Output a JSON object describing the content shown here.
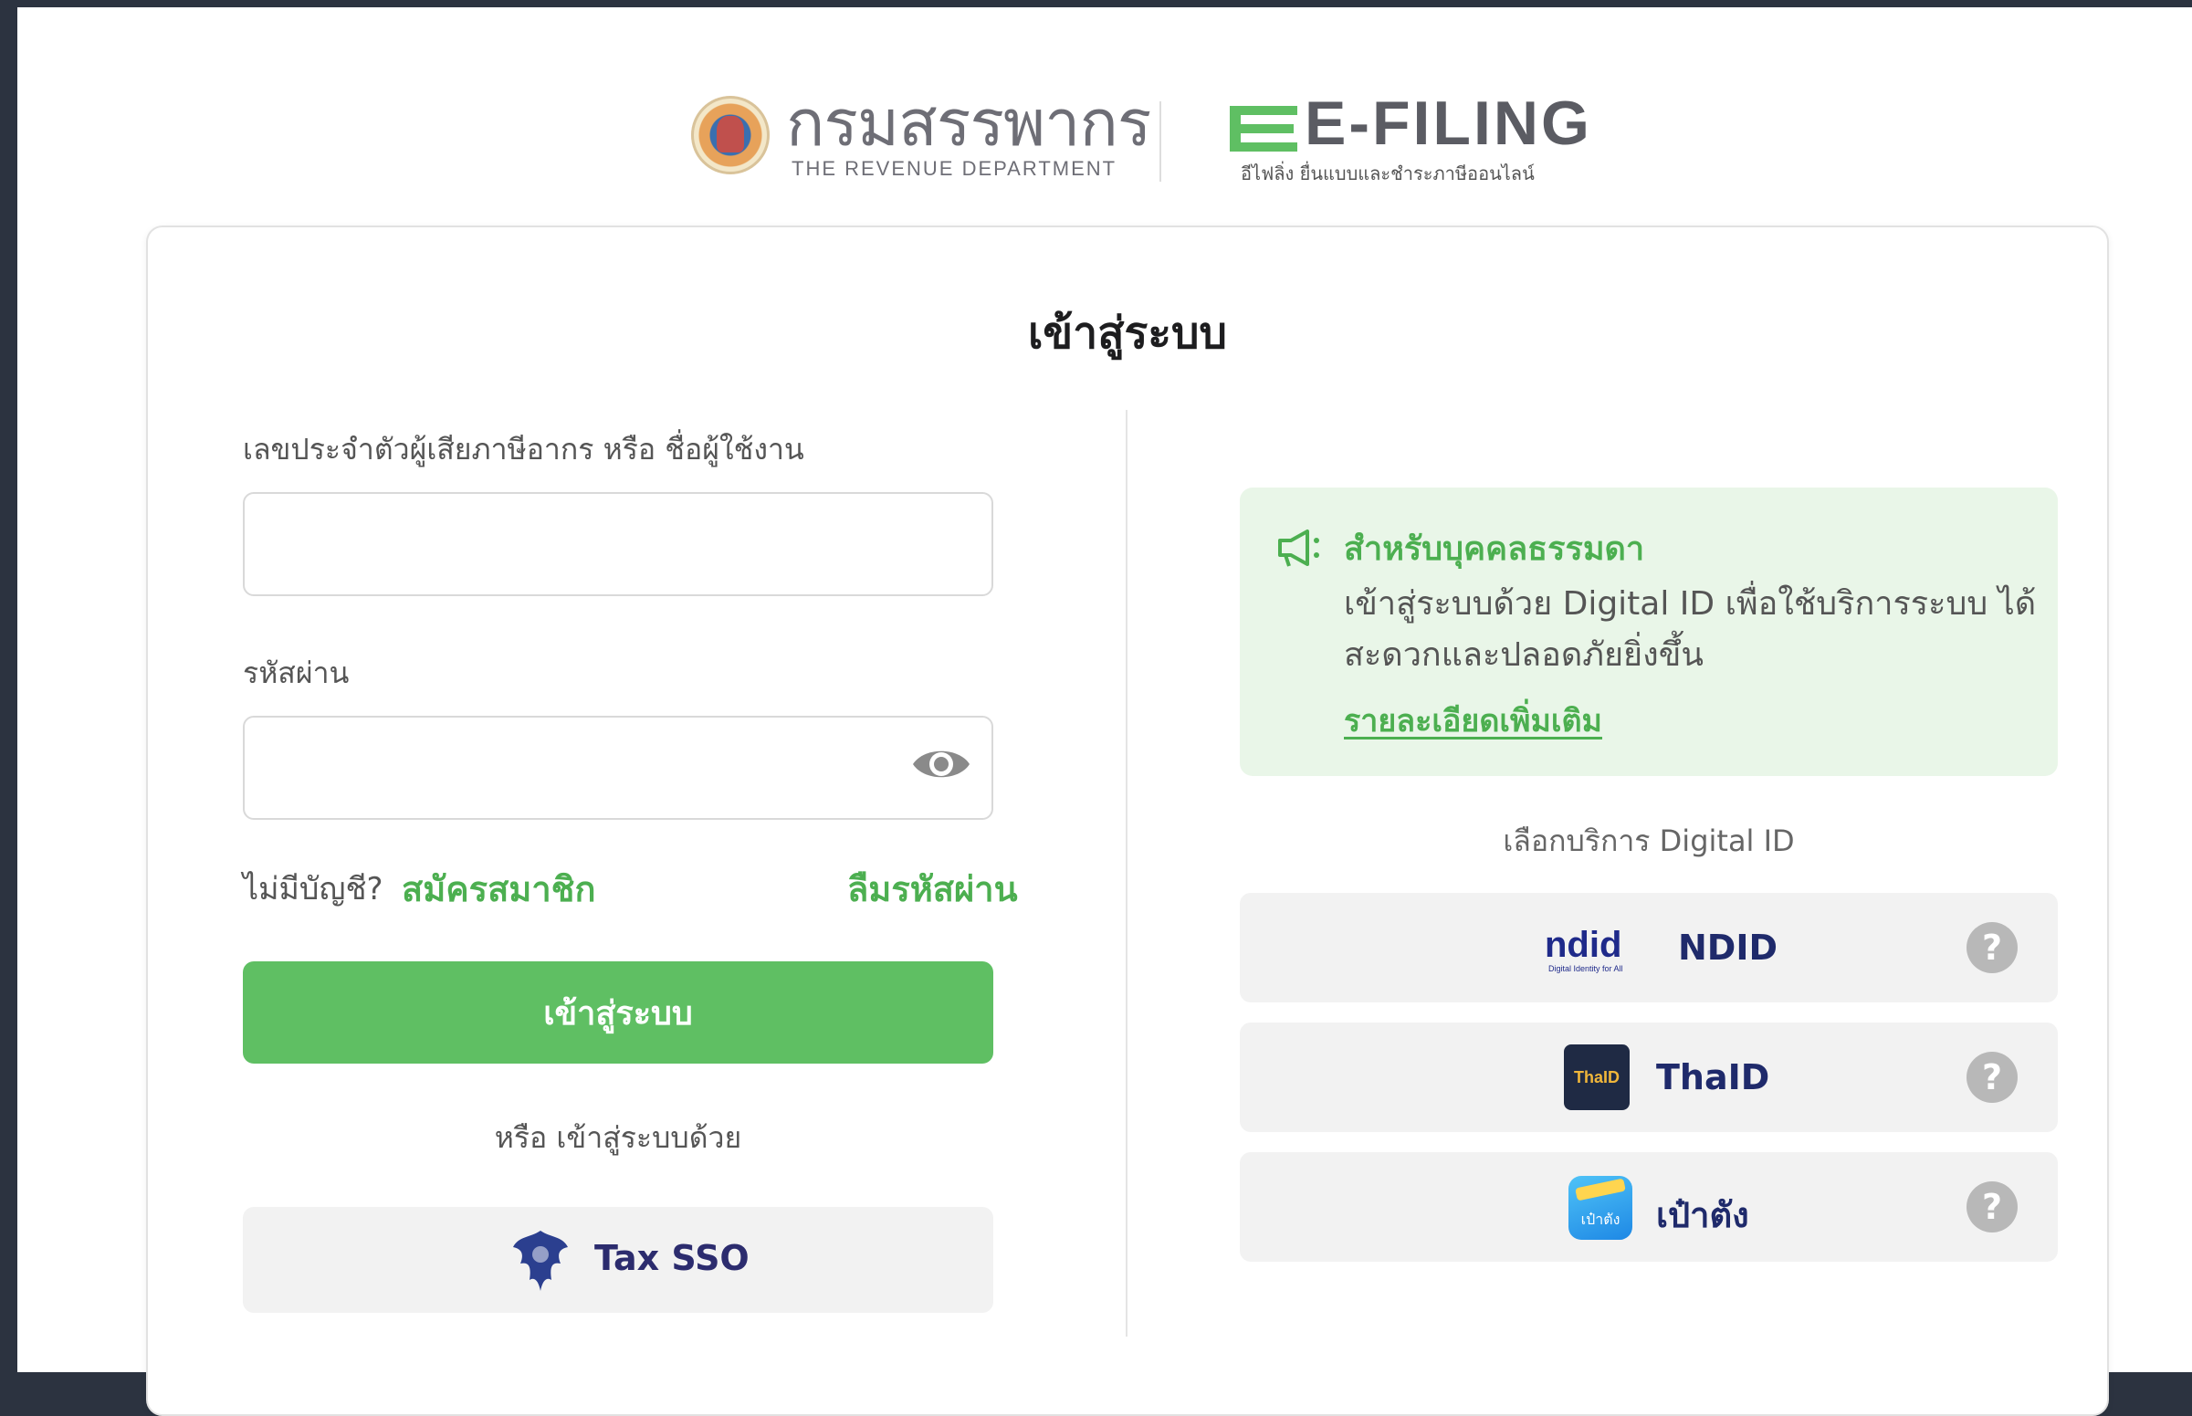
{
  "header": {
    "rd_name": "กรมสรรพากร",
    "rd_english": "THE REVENUE DEPARTMENT",
    "efiling_title": "E-FILING",
    "efiling_subtitle": "อีไฟลิ่ง ยื่นแบบและชำระภาษีออนไลน์"
  },
  "card": {
    "title": "เข้าสู่ระบบ"
  },
  "login": {
    "username_label": "เลขประจำตัวผู้เสียภาษีอากร หรือ ชื่อผู้ใช้งาน",
    "username_value": "",
    "password_label": "รหัสผ่าน",
    "password_value": "",
    "no_account_text": "ไม่มีบัญชี?",
    "register_link": "สมัครสมาชิก",
    "forgot_link": "ลืมรหัสผ่าน",
    "submit_label": "เข้าสู่ระบบ",
    "or_text": "หรือ เข้าสู่ระบบด้วย",
    "sso_label": "Tax SSO"
  },
  "notice": {
    "title": "สำหรับบุคคลธรรมดา",
    "body": "เข้าสู่ระบบด้วย Digital ID เพื่อใช้บริการระบบ ได้สะดวกและปลอดภัยยิ่งขึ้น",
    "link": "รายละเอียดเพิ่มเติม"
  },
  "digital_id": {
    "choose_label": "เลือกบริการ Digital ID",
    "services": [
      {
        "label": "NDID",
        "logo_text": "ndid",
        "logo_subtext": "Digital Identity for All",
        "help": "?"
      },
      {
        "label": "ThaID",
        "logo_text": "ThaID",
        "help": "?"
      },
      {
        "label": "เป๋าตัง",
        "logo_text": "เป๋าตัง",
        "help": "?"
      }
    ]
  },
  "colors": {
    "accent_green": "#5fbf63",
    "link_green": "#4caf50",
    "notice_bg": "#e9f6e8",
    "page_frame": "#2c3340"
  }
}
